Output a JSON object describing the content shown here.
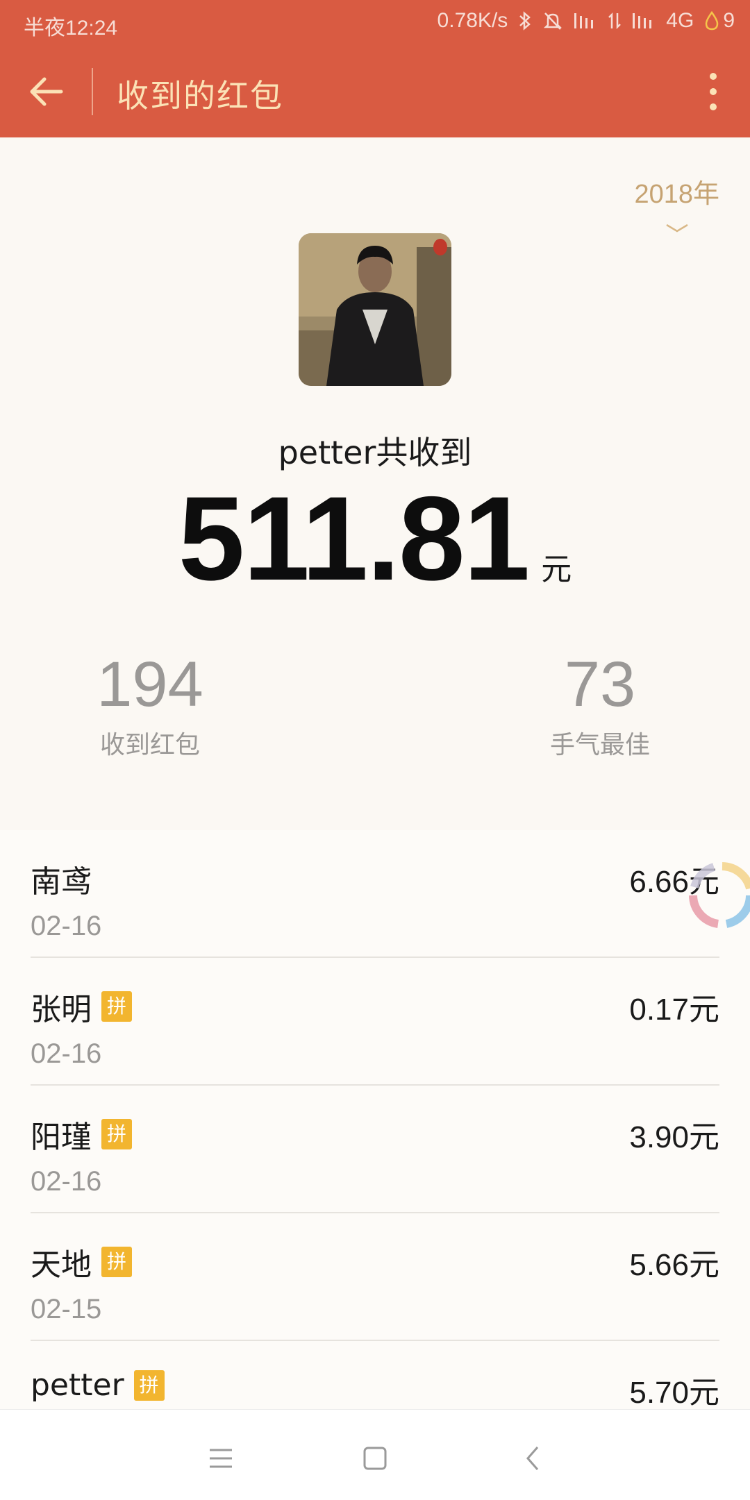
{
  "status_bar": {
    "time": "半夜12:24",
    "net_speed": "0.78K/s",
    "network": "4G",
    "battery": "9"
  },
  "toolbar": {
    "title": "收到的红包",
    "back_icon": "arrow-left-icon",
    "more_icon": "more-vertical-icon"
  },
  "summary": {
    "year": "2018年",
    "title": "petter共收到",
    "total_amount": "511.81",
    "unit": "元",
    "stats": [
      {
        "value": "194",
        "label": "收到红包"
      },
      {
        "value": "73",
        "label": "手气最佳"
      }
    ]
  },
  "list": [
    {
      "name": "南鸢",
      "badge": "",
      "date": "02-16",
      "amount": "6.66元"
    },
    {
      "name": "张明",
      "badge": "拼",
      "date": "02-16",
      "amount": "0.17元"
    },
    {
      "name": "阳瑾",
      "badge": "拼",
      "date": "02-16",
      "amount": "3.90元"
    },
    {
      "name": "天地",
      "badge": "拼",
      "date": "02-15",
      "amount": "5.66元"
    },
    {
      "name": "petter",
      "badge": "拼",
      "date": "",
      "amount": "5.70元"
    }
  ],
  "colors": {
    "brand": "#d95b42",
    "title": "#fbe2b6",
    "year": "#c6a372",
    "badge": "#f2b52f"
  }
}
